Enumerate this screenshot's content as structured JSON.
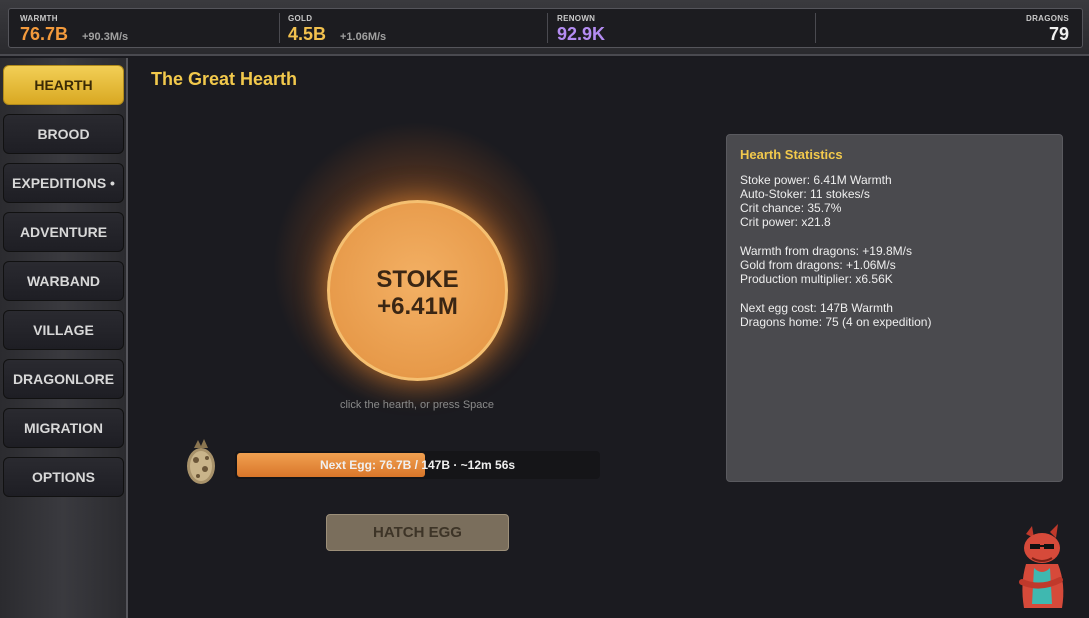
{
  "resources": {
    "warmth": {
      "label": "WARMTH",
      "value": "76.7B",
      "rate": "+90.3M/s",
      "color": "#f39a3c"
    },
    "gold": {
      "label": "GOLD",
      "value": "4.5B",
      "rate": "+1.06M/s",
      "color": "#f2c14e"
    },
    "renown": {
      "label": "RENOWN",
      "value": "92.9K",
      "color": "#b48cf2"
    },
    "dragons": {
      "label": "DRAGONS",
      "value": "79",
      "color": "#f0f0f0"
    }
  },
  "nav": {
    "items": [
      {
        "label": "HEARTH",
        "active": true
      },
      {
        "label": "BROOD"
      },
      {
        "label": "EXPEDITIONS •"
      },
      {
        "label": "ADVENTURE"
      },
      {
        "label": "WARBAND"
      },
      {
        "label": "VILLAGE"
      },
      {
        "label": "DRAGONLORE"
      },
      {
        "label": "MIGRATION"
      },
      {
        "label": "OPTIONS"
      }
    ]
  },
  "main": {
    "title": "The Great Hearth",
    "stoke": {
      "line1": "STOKE",
      "line2": "+6.41M"
    },
    "hint": "click the hearth, or press Space",
    "egg_progress": {
      "text": "Next Egg:  76.7B / 147B   ·   ~12m 56s",
      "fraction": 0.522
    },
    "hatch_label": "HATCH EGG"
  },
  "stats": {
    "title": "Hearth Statistics",
    "lines": [
      "Stoke power:  6.41M Warmth",
      "Auto-Stoker:  11 stokes/s",
      "Crit chance:  35.7%",
      "Crit power:  x21.8",
      "Warmth from dragons:  +19.8M/s",
      "Gold from dragons:  +1.06M/s",
      "Production multiplier:  x6.56K",
      "Next egg cost:  147B Warmth",
      "Dragons home:  75  (4 on expedition)"
    ]
  },
  "icons": {
    "egg": "dragon-egg-icon",
    "mascot": "dragon-mascot-icon"
  }
}
